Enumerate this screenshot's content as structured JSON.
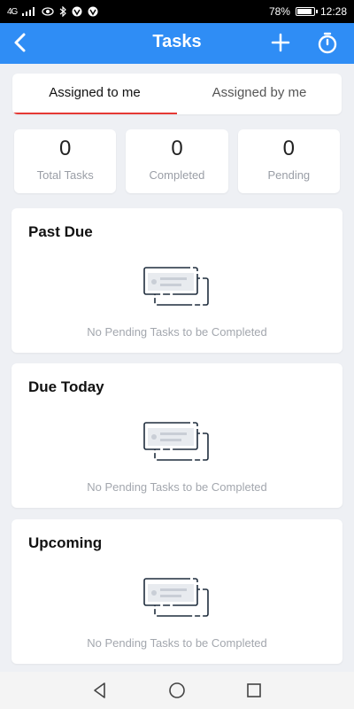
{
  "status_bar": {
    "network": "4G",
    "battery": "78%",
    "battery_level": 0.78,
    "time": "12:28"
  },
  "header": {
    "title": "Tasks",
    "icons": [
      "back-arrow-icon",
      "plus-icon",
      "timer-icon"
    ],
    "color": "#2f8df5"
  },
  "tabs": [
    {
      "label": "Assigned to me",
      "active": true
    },
    {
      "label": "Assigned by me",
      "active": false
    }
  ],
  "accent_color": "#e53935",
  "stats": [
    {
      "value": "0",
      "label": "Total Tasks"
    },
    {
      "value": "0",
      "label": "Completed"
    },
    {
      "value": "0",
      "label": "Pending"
    }
  ],
  "sections": [
    {
      "title": "Past Due",
      "empty_text": "No Pending Tasks to be Completed"
    },
    {
      "title": "Due Today",
      "empty_text": "No Pending Tasks to be Completed"
    },
    {
      "title": "Upcoming",
      "empty_text": "No Pending Tasks to be Completed"
    }
  ],
  "navbar": {
    "icons": [
      "back-triangle-icon",
      "home-circle-icon",
      "recents-square-icon"
    ]
  }
}
